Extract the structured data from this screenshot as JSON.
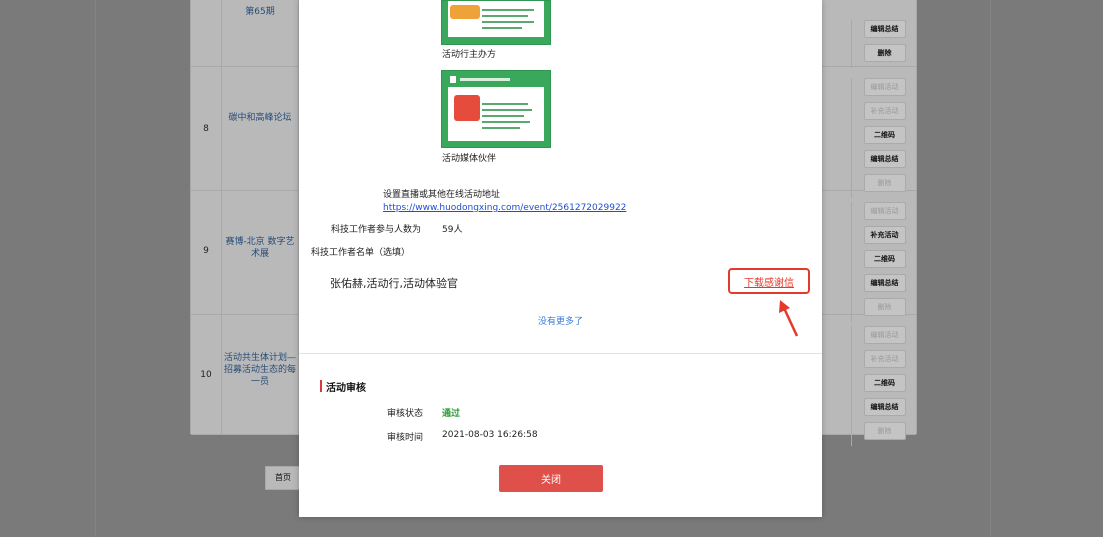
{
  "background": {
    "rows": [
      {
        "num": "",
        "name": "第65期",
        "actions": [
          "编辑总结",
          "删除"
        ],
        "muted": [
          false,
          false
        ]
      },
      {
        "num": "8",
        "name": "碳中和高峰论坛",
        "actions": [
          "编辑活动",
          "补充活动",
          "二维码",
          "编辑总结",
          "删除"
        ],
        "muted": [
          true,
          true,
          false,
          false,
          true
        ]
      },
      {
        "num": "9",
        "name": "赛博-北京 数字艺术展",
        "actions": [
          "编辑活动",
          "补充活动",
          "二维码",
          "编辑总结",
          "删除"
        ],
        "muted": [
          true,
          false,
          false,
          false,
          true
        ]
      },
      {
        "num": "10",
        "name": "活动共生体计划—招募活动生态的每一员",
        "actions": [
          "编辑活动",
          "补充活动",
          "二维码",
          "编辑总结",
          "删除"
        ],
        "muted": [
          true,
          true,
          false,
          false,
          true
        ]
      }
    ],
    "pager_first": "首页"
  },
  "modal": {
    "organizer_caption": "活动行主办方",
    "media_caption": "活动媒体伙伴",
    "live_label": "设置直播或其他在线活动地址",
    "live_url": "https://www.huodongxing.com/event/2561272029922",
    "participants_label": "科技工作者参与人数为",
    "participants_value": "59人",
    "namelist_label": "科技工作者名单（选填）",
    "namelist_value": "张佑赫,活动行,活动体验官",
    "download_label": "下载感谢信",
    "no_more": "没有更多了",
    "review": {
      "title": "活动审核",
      "status_label": "审核状态",
      "status_value": "通过",
      "time_label": "审核时间",
      "time_value": "2021-08-03 16:26:58"
    },
    "close_label": "关闭"
  },
  "colors": {
    "accent_red": "#e0504b",
    "annotation_red": "#e43a2c",
    "link_blue": "#1f4fd1",
    "approved_green": "#2d9c3b",
    "poster_green": "#39a85b"
  },
  "icons": {
    "annotation_arrow": "arrow-up-left-icon"
  }
}
